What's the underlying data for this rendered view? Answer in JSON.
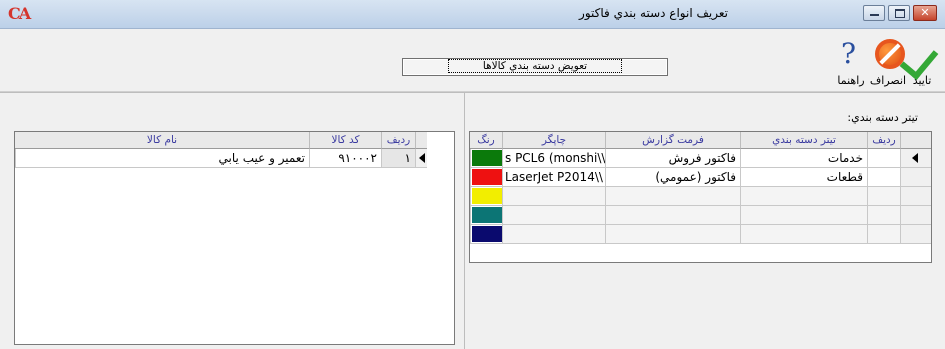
{
  "window": {
    "title": "تعريف انواع دسته بندي فاكتور",
    "close_glyph": "✕"
  },
  "toolbar": {
    "ok_label": "تاييد",
    "cancel_label": "انصراف",
    "help_label": "راهنما",
    "change_categories_label": "تعويض دسته بندي كالاها"
  },
  "right_panel": {
    "field_label": "تيتر دسته بندي:",
    "columns": {
      "row_no": "رديف",
      "category_title": "تيتر دسته بندي",
      "report_format": "فرمت گزارش",
      "printer": "چاپگر",
      "color": "رنگ"
    },
    "rows": [
      {
        "category_title": "خدمات",
        "report_format": "فاكتور فروش",
        "printer": "s PCL6 (monshi\\\\",
        "color": "#0b7a0b"
      },
      {
        "category_title": "قطعات",
        "report_format": "فاكتور (عمومي)",
        "printer": "LaserJet P2014\\\\",
        "color": "#ee1111"
      },
      {
        "category_title": "",
        "report_format": "",
        "printer": "",
        "color": "#f2ee00"
      },
      {
        "category_title": "",
        "report_format": "",
        "printer": "",
        "color": "#0c7575"
      },
      {
        "category_title": "",
        "report_format": "",
        "printer": "",
        "color": "#0a0a6e"
      }
    ]
  },
  "left_panel": {
    "columns": {
      "row_no": "رديف",
      "item_code": "كد كالا",
      "item_name": "نام كالا"
    },
    "rows": [
      {
        "row_no": "١",
        "item_code": "٩١٠٠٠٢",
        "item_name": "تعمير و عيب يابي"
      }
    ]
  }
}
